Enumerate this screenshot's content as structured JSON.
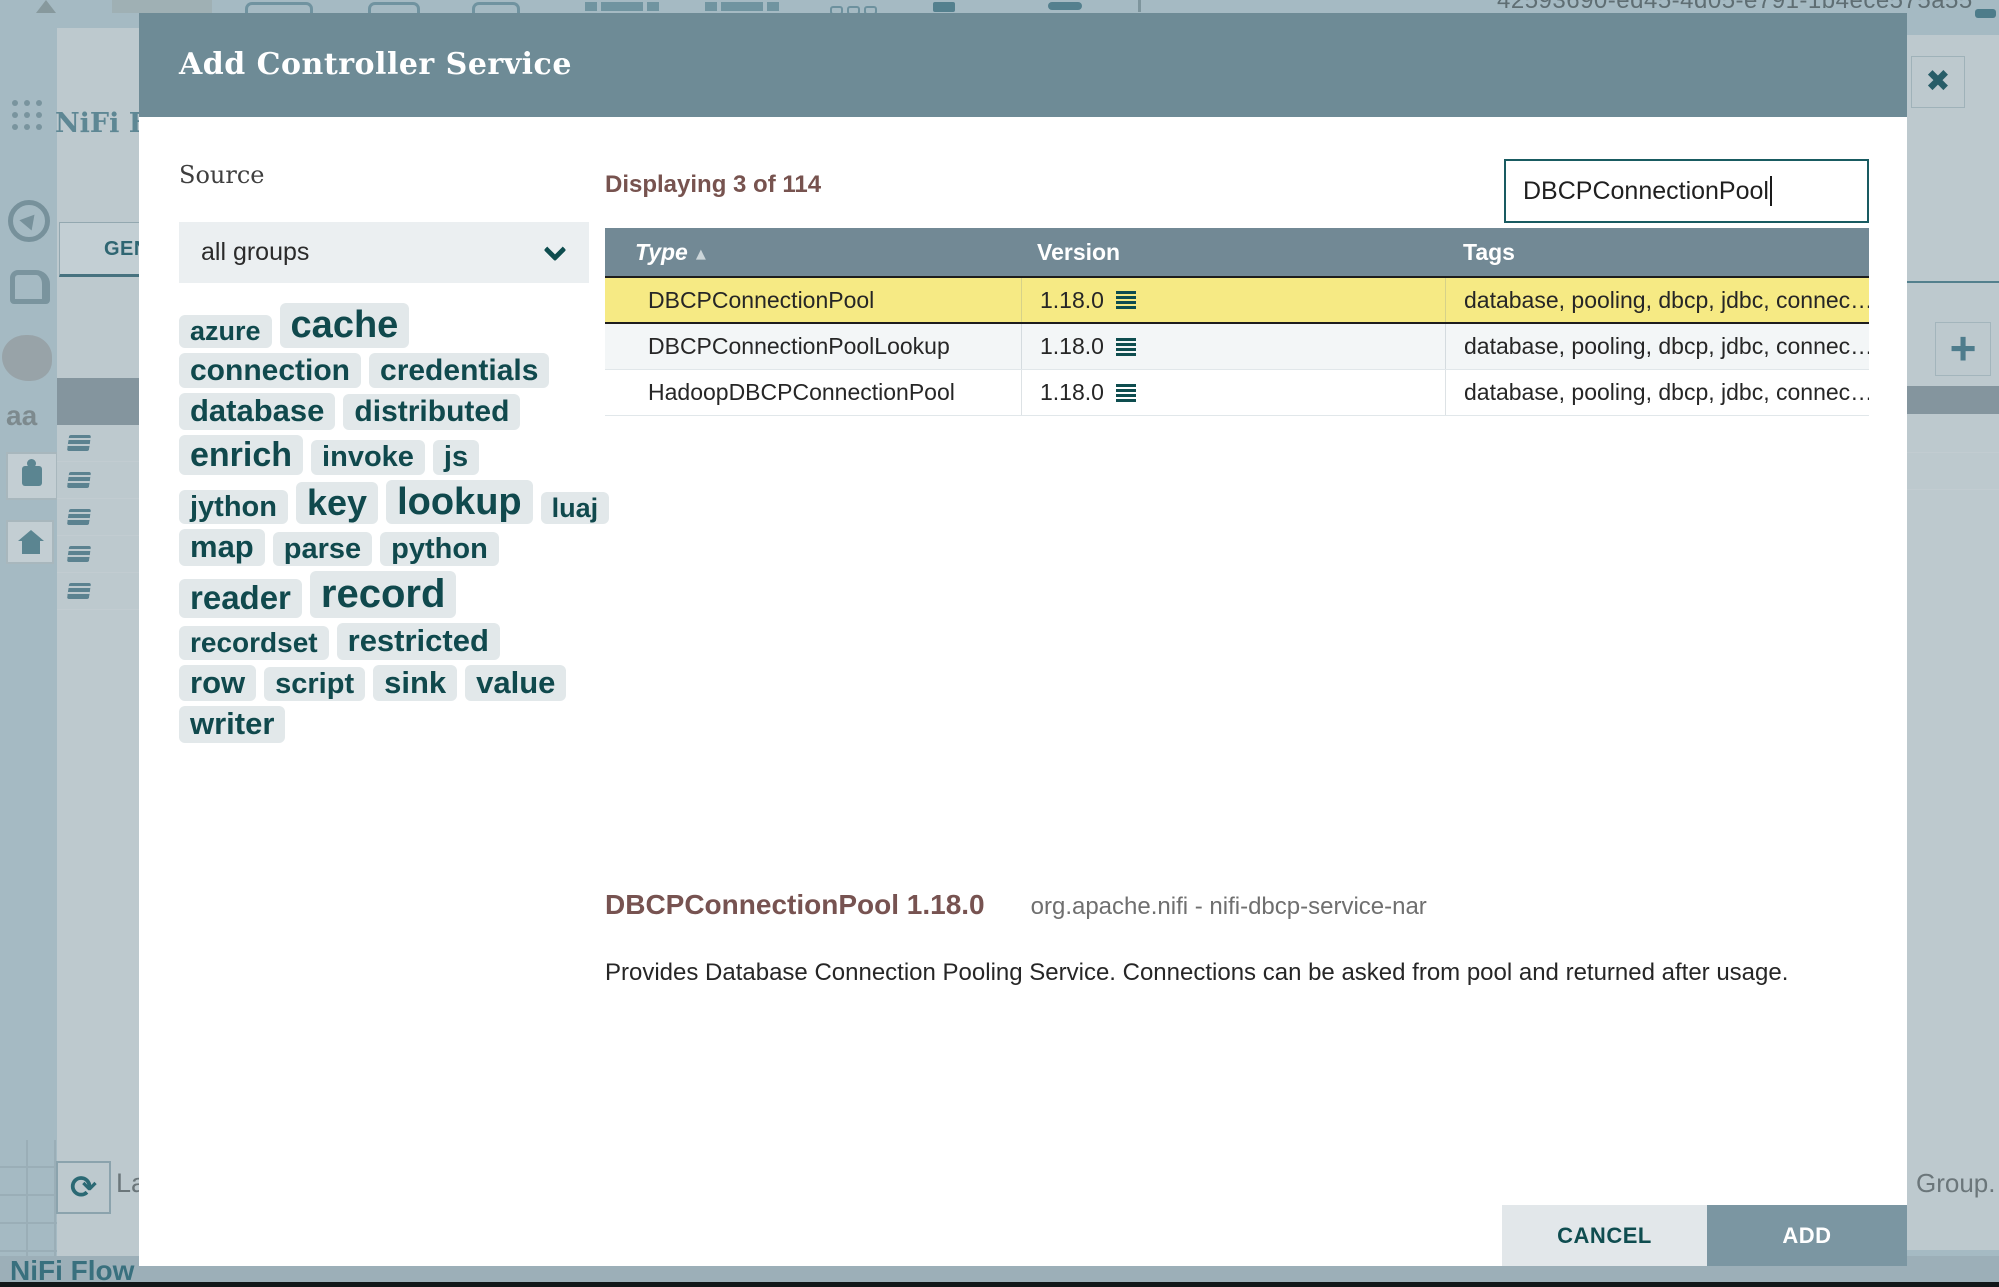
{
  "backdrop": {
    "uuid_fragment": "42593690-ed45-4d05-e791-1b4ece575a55",
    "flow_config_title_fragment": "NiFi F",
    "general_tab_fragment": "GEN",
    "last_updated_fragment": "La",
    "group_text_fragment": "Group.",
    "breadcrumb": "NiFi Flow",
    "palette_text_fragment": "aa"
  },
  "icons": {
    "close": "✖",
    "plus": "+",
    "refresh": "⟳",
    "sort_asc": "▲"
  },
  "dialog": {
    "title": "Add Controller Service",
    "source": {
      "label": "Source",
      "selected_option": "all groups"
    },
    "tag_rows": [
      [
        {
          "label": "azure",
          "size": 27
        },
        {
          "label": "cache",
          "size": 38
        }
      ],
      [
        {
          "label": "connection",
          "size": 30
        },
        {
          "label": "credentials",
          "size": 30
        }
      ],
      [
        {
          "label": "database",
          "size": 31
        },
        {
          "label": "distributed",
          "size": 30
        }
      ],
      [
        {
          "label": "enrich",
          "size": 34
        },
        {
          "label": "invoke",
          "size": 29
        },
        {
          "label": "js",
          "size": 29
        }
      ],
      [
        {
          "label": "jython",
          "size": 29
        },
        {
          "label": "key",
          "size": 36
        },
        {
          "label": "lookup",
          "size": 38
        },
        {
          "label": "luaj",
          "size": 27
        }
      ],
      [
        {
          "label": "map",
          "size": 31
        },
        {
          "label": "parse",
          "size": 29
        },
        {
          "label": "python",
          "size": 29
        }
      ],
      [
        {
          "label": "reader",
          "size": 33
        },
        {
          "label": "record",
          "size": 40
        }
      ],
      [
        {
          "label": "recordset",
          "size": 28
        },
        {
          "label": "restricted",
          "size": 31
        }
      ],
      [
        {
          "label": "row",
          "size": 31
        },
        {
          "label": "script",
          "size": 29
        },
        {
          "label": "sink",
          "size": 31
        },
        {
          "label": "value",
          "size": 31
        }
      ],
      [
        {
          "label": "writer",
          "size": 31
        }
      ]
    ],
    "results": {
      "count_text": "Displaying 3 of 114",
      "filter_value": "DBCPConnectionPool",
      "columns": {
        "type": "Type",
        "version": "Version",
        "tags": "Tags"
      },
      "rows": [
        {
          "type": "DBCPConnectionPool",
          "version": "1.18.0",
          "tags": "database, pooling, dbcp, jdbc, connec…",
          "selected": true
        },
        {
          "type": "DBCPConnectionPoolLookup",
          "version": "1.18.0",
          "tags": "database, pooling, dbcp, jdbc, connec…",
          "selected": false
        },
        {
          "type": "HadoopDBCPConnectionPool",
          "version": "1.18.0",
          "tags": "database, pooling, dbcp, jdbc, connec…",
          "selected": false
        }
      ]
    },
    "details": {
      "title": "DBCPConnectionPool 1.18.0",
      "bundle": "org.apache.nifi - nifi-dbcp-service-nar",
      "description": "Provides Database Connection Pooling Service. Connections can be asked from pool and returned after usage."
    },
    "buttons": {
      "cancel": "CANCEL",
      "add": "ADD"
    }
  },
  "colors": {
    "dialog_header_bg": "#6e8b96",
    "table_header_bg": "#728995",
    "selection_yellow": "#f6ea84",
    "accent_teal": "#0e4d4f",
    "value_brown": "#775351",
    "add_button_bg": "#7b96a2",
    "cancel_button_bg": "#e2e7ea",
    "canvas_wash": "#a5bac3"
  }
}
